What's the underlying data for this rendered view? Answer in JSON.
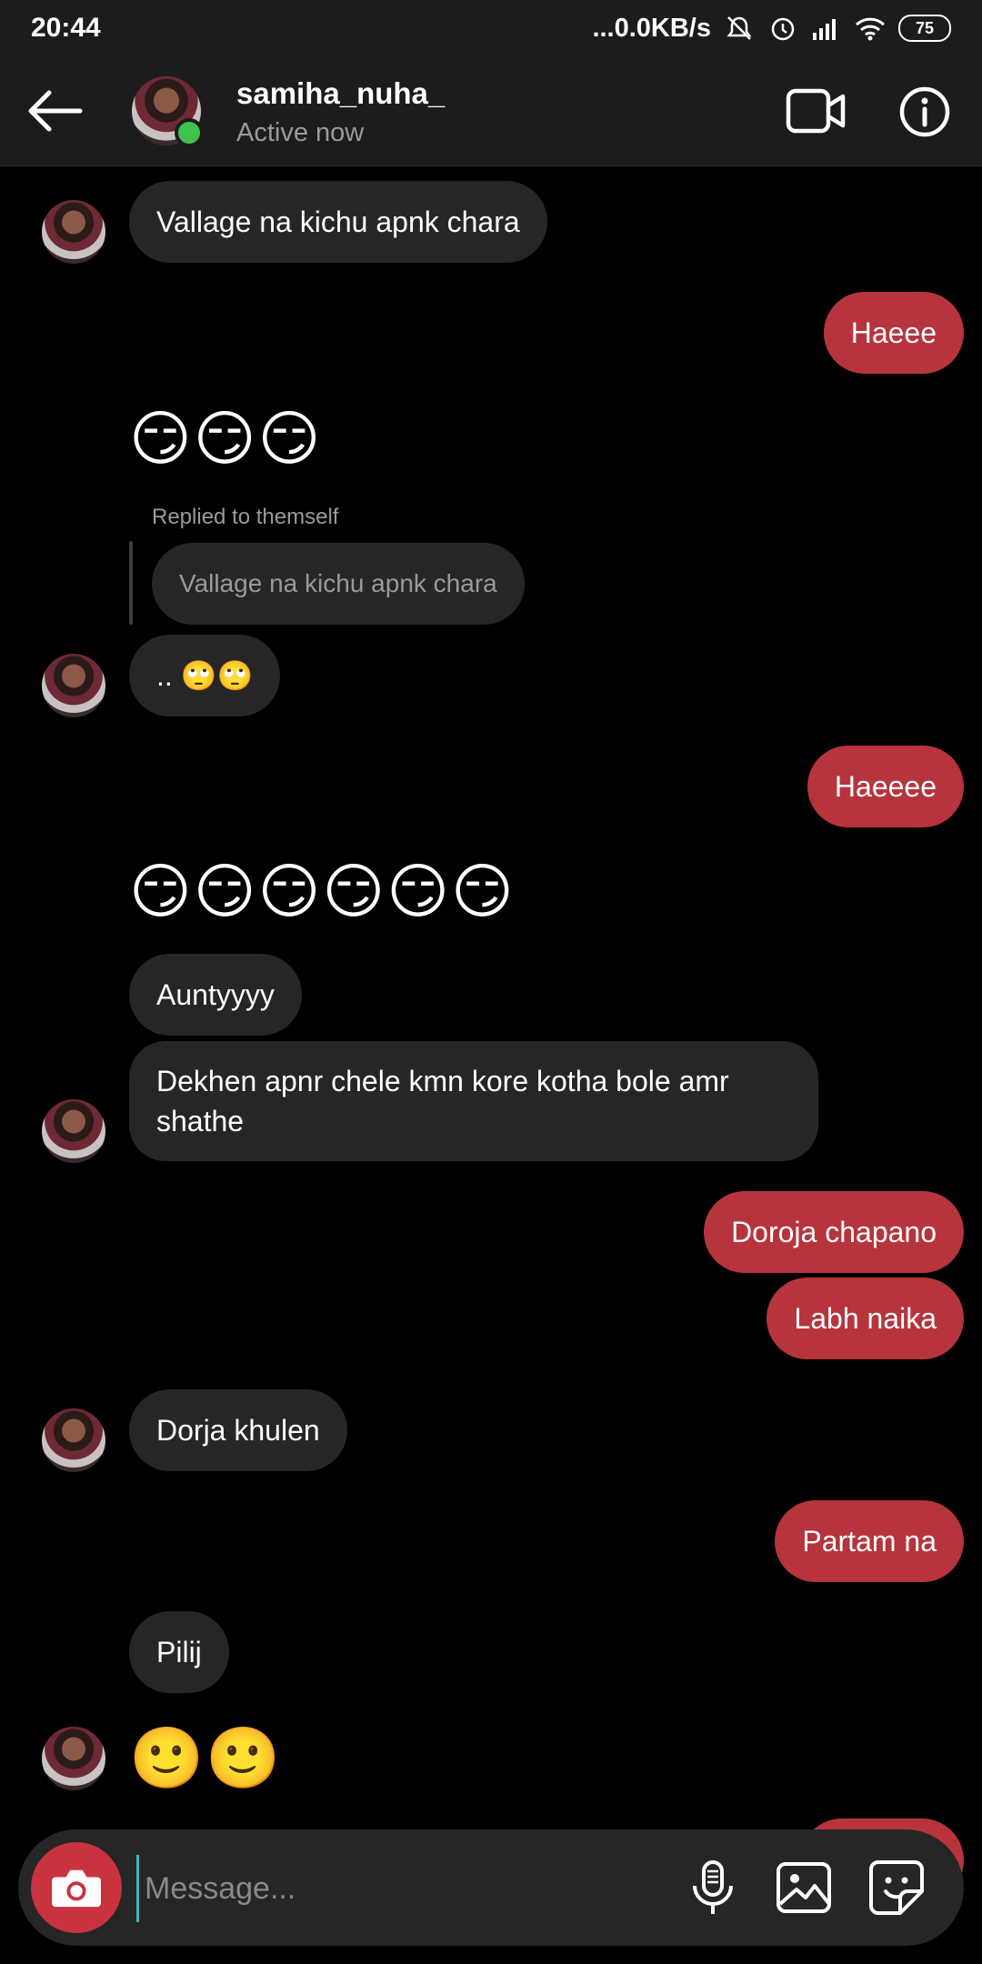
{
  "status_bar": {
    "time": "20:44",
    "network_speed": "...0.0KB/s",
    "battery": "75"
  },
  "header": {
    "username": "samiha_nuha_",
    "status": "Active now"
  },
  "messages": {
    "m1": "Vallage na kichu apnk chara",
    "m2": "Haeee",
    "m3": "😏😏😏",
    "reply_label": "Replied to themself",
    "reply_quote": "Vallage na kichu apnk chara",
    "m4": ".. 🙄🙄",
    "m5": "Haeeee",
    "m6": "😏😏😏😏😏😏",
    "m7": "Auntyyyy",
    "m8_line1": "Dekhen apnr chele kmn kore kotha bole amr",
    "m8_line2": "shathe",
    "m9": "Doroja chapano",
    "m10": "Labh naika",
    "m11": "Dorja khulen",
    "m12": "Partam na",
    "m13": "Pilij",
    "m14": "🙂🙂"
  },
  "composer": {
    "placeholder": "Message..."
  },
  "colors": {
    "incoming_bubble": "#262626",
    "outgoing_bubble": "#b7343c",
    "online": "#3ec24c",
    "camera_button": "#c8333d"
  },
  "icons": [
    "back-arrow-icon",
    "video-call-icon",
    "info-icon",
    "camera-icon",
    "microphone-icon",
    "gallery-icon",
    "sticker-icon",
    "mute-icon",
    "alarm-icon",
    "signal-icon",
    "wifi-icon"
  ]
}
